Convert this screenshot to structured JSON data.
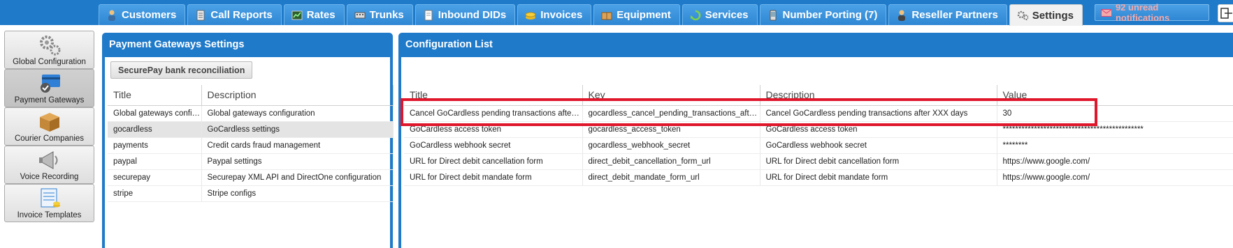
{
  "nav": {
    "tabs": [
      {
        "label": "Customers",
        "icon": "customers-icon"
      },
      {
        "label": "Call Reports",
        "icon": "call-reports-icon"
      },
      {
        "label": "Rates",
        "icon": "rates-icon"
      },
      {
        "label": "Trunks",
        "icon": "trunks-icon"
      },
      {
        "label": "Inbound DIDs",
        "icon": "inbound-dids-icon"
      },
      {
        "label": "Invoices",
        "icon": "invoices-icon"
      },
      {
        "label": "Equipment",
        "icon": "equipment-icon"
      },
      {
        "label": "Services",
        "icon": "services-icon"
      },
      {
        "label": "Number Porting (7)",
        "icon": "number-porting-icon"
      },
      {
        "label": "Reseller Partners",
        "icon": "reseller-partners-icon"
      },
      {
        "label": "Settings",
        "icon": "settings-icon"
      }
    ],
    "active_tab": "Settings",
    "notifications": "92 unread notifications"
  },
  "sidebar": {
    "items": [
      {
        "label": "Global Configuration",
        "icon": "gears-icon"
      },
      {
        "label": "Payment Gateways",
        "icon": "payment-card-icon"
      },
      {
        "label": "Courier Companies",
        "icon": "package-box-icon"
      },
      {
        "label": "Voice Recording",
        "icon": "megaphone-icon"
      },
      {
        "label": "Invoice Templates",
        "icon": "invoice-calculator-icon"
      }
    ],
    "active": "Payment Gateways"
  },
  "gateways_panel": {
    "title": "Payment Gateways Settings",
    "button": "SecurePay bank reconciliation",
    "columns": [
      "Title",
      "Description"
    ],
    "rows": [
      {
        "title": "Global gateways configuration",
        "description": "Global gateways configuration"
      },
      {
        "title": "gocardless",
        "description": "GoCardless settings"
      },
      {
        "title": "payments",
        "description": "Credit cards fraud management"
      },
      {
        "title": "paypal",
        "description": "Paypal settings"
      },
      {
        "title": "securepay",
        "description": "Securepay XML API and DirectOne configuration"
      },
      {
        "title": "stripe",
        "description": "Stripe configs"
      }
    ],
    "selected_row": "gocardless"
  },
  "config_panel": {
    "title": "Configuration List",
    "columns": [
      "Title",
      "Key",
      "Description",
      "Value"
    ],
    "rows": [
      {
        "title": "Cancel GoCardless pending transactions after days",
        "key": "gocardless_cancel_pending_transactions_after_days",
        "description": "Cancel GoCardless pending transactions after XXX days",
        "value": "30"
      },
      {
        "title": "GoCardless access token",
        "key": "gocardless_access_token",
        "description": "GoCardless access token",
        "value": "*********************************************"
      },
      {
        "title": "GoCardless webhook secret",
        "key": "gocardless_webhook_secret",
        "description": "GoCardless webhook secret",
        "value": "********"
      },
      {
        "title": "URL for Direct debit cancellation form",
        "key": "direct_debit_cancellation_form_url",
        "description": "URL for Direct debit cancellation form",
        "value": "https://www.google.com/"
      },
      {
        "title": "URL for Direct debit mandate form",
        "key": "direct_debit_mandate_form_url",
        "description": "URL for Direct debit mandate form",
        "value": "https://www.google.com/"
      }
    ],
    "highlighted_row": "Cancel GoCardless pending transactions after days"
  },
  "colors": {
    "header_blue": "#1f7ac9",
    "highlight_red": "#e0162b",
    "notification_text": "#f5a9a9"
  }
}
